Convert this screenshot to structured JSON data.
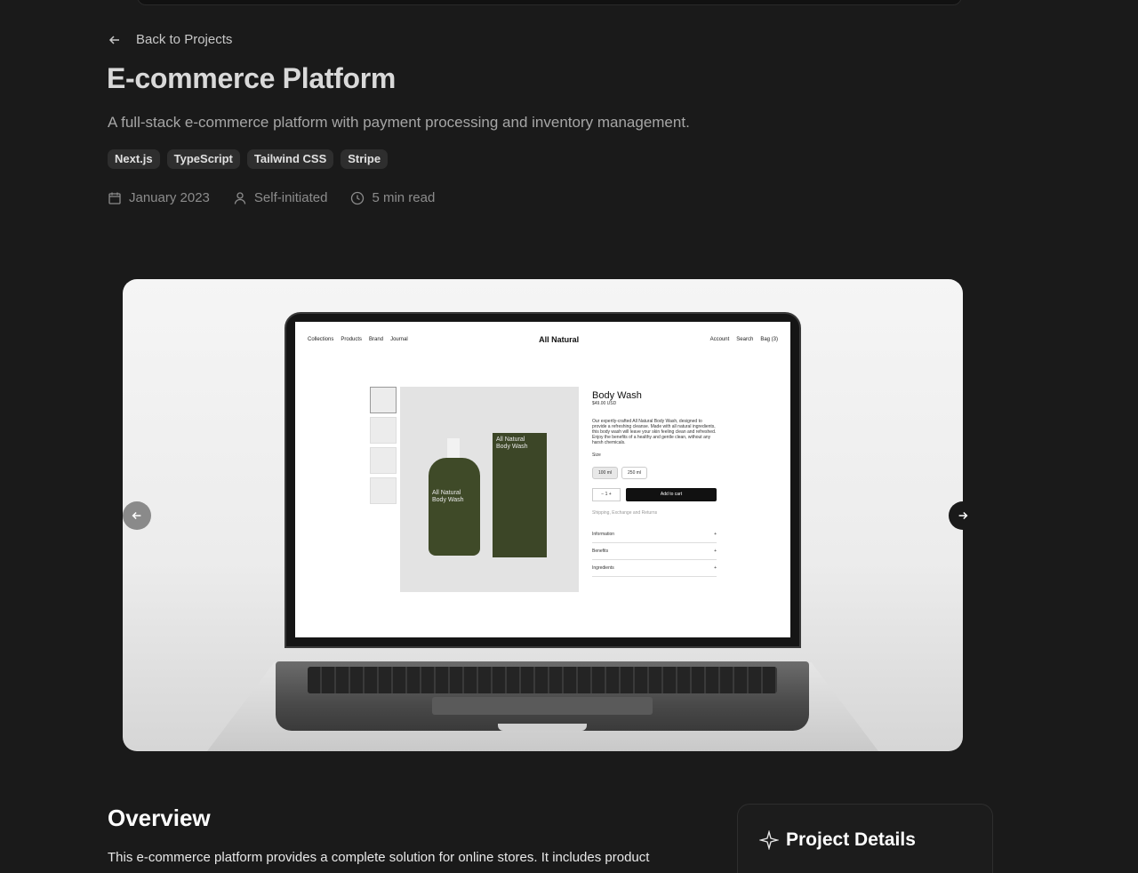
{
  "nav": {
    "back_label": "Back to Projects"
  },
  "project": {
    "title": "E-commerce Platform",
    "subtitle": "A full-stack e-commerce platform with payment processing and inventory management.",
    "tags": [
      "Next.js",
      "TypeScript",
      "Tailwind CSS",
      "Stripe"
    ],
    "meta": {
      "date": "January 2023",
      "role": "Self-initiated",
      "read_time": "5 min read"
    }
  },
  "mockup": {
    "nav_left": [
      "Collections",
      "Products",
      "Brand",
      "Journal"
    ],
    "brand": "All Natural",
    "nav_right": [
      "Account",
      "Search",
      "Bag (3)"
    ],
    "product_name": "Body Wash",
    "price": "$49.00 USD",
    "description": "Our expertly-crafted All Natural Body Wash, designed to provide a refreshing cleanse. Made with all natural ingredients, this body wash will leave your skin feeling clean and refreshed. Enjoy the benefits of a healthy and gentle clean, without any harsh chemicals.",
    "size_label": "Size",
    "sizes": [
      "100 ml",
      "250 ml"
    ],
    "qty": "−  1  +",
    "add_to_cart": "Add to cart",
    "shipping": "Shipping, Exchange and Returns",
    "accordions": [
      "Information",
      "Benefits",
      "Ingredients"
    ],
    "label_brand": "All Natural",
    "label_product": "Body Wash"
  },
  "overview": {
    "title": "Overview",
    "text": "This e-commerce platform provides a complete solution for online stores. It includes product"
  },
  "details": {
    "title": "Project Details"
  },
  "icons": {
    "back": "arrow-left-icon",
    "date": "calendar-icon",
    "role": "user-icon",
    "time": "clock-icon",
    "prev": "arrow-left-icon",
    "next": "arrow-right-icon",
    "details": "sparkle-icon"
  }
}
